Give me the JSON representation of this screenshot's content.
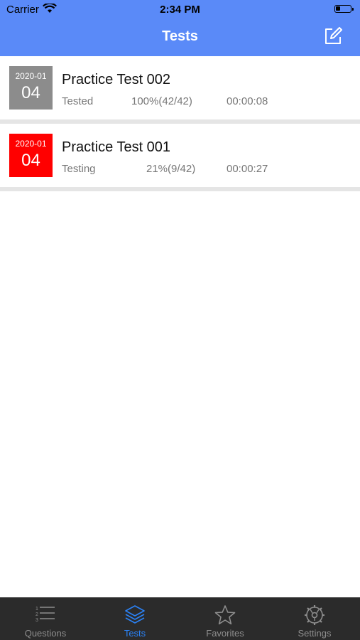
{
  "status_bar": {
    "carrier": "Carrier",
    "time": "2:34 PM"
  },
  "nav": {
    "title": "Tests",
    "compose_icon": "compose-icon"
  },
  "tests": [
    {
      "date_ym": "2020-01",
      "date_day": "04",
      "badge_color": "#8c8c8c",
      "title": "Practice Test 002",
      "status": "Tested",
      "progress": "100%(42/42)",
      "duration": "00:00:08"
    },
    {
      "date_ym": "2020-01",
      "date_day": "04",
      "badge_color": "#ff0000",
      "title": "Practice Test 001",
      "status": "Testing",
      "progress": "21%(9/42)",
      "duration": "00:00:27"
    }
  ],
  "tabbar": {
    "active": "Tests",
    "active_color": "#2b82f6",
    "items": [
      {
        "label": "Questions",
        "icon": "list-icon"
      },
      {
        "label": "Tests",
        "icon": "layers-icon"
      },
      {
        "label": "Favorites",
        "icon": "star-icon"
      },
      {
        "label": "Settings",
        "icon": "gear-icon"
      }
    ]
  },
  "colors": {
    "header_bg": "#5a8af8",
    "tabbar_bg": "#2b2b2b"
  }
}
